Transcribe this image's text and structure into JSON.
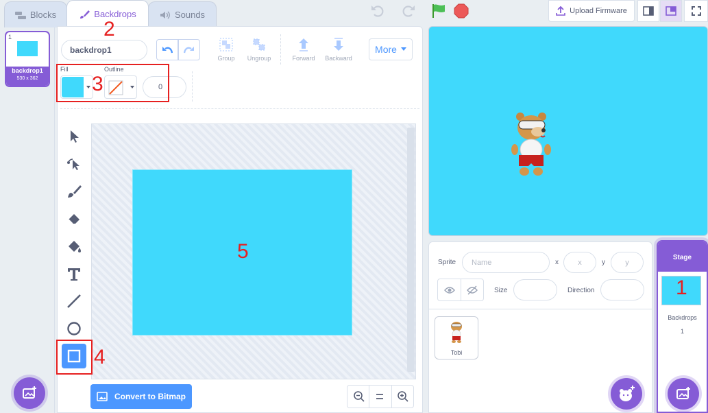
{
  "tabs": [
    {
      "label": "Blocks"
    },
    {
      "label": "Backdrops"
    },
    {
      "label": "Sounds"
    }
  ],
  "header": {
    "upload_firmware": "Upload Firmware"
  },
  "backdrop_list": [
    {
      "index": "1",
      "name": "backdrop1",
      "size": "530 x 362"
    }
  ],
  "toolbar": {
    "name_value": "backdrop1",
    "group": "Group",
    "ungroup": "Ungroup",
    "forward": "Forward",
    "backward": "Backward",
    "more": "More"
  },
  "style": {
    "fill_label": "Fill",
    "outline_label": "Outline",
    "outline_width": "0",
    "fill_color": "#40d9fc"
  },
  "canvas": {
    "convert_label": "Convert to Bitmap"
  },
  "sprite_info": {
    "sprite_label": "Sprite",
    "name_placeholder": "Name",
    "x_label": "x",
    "x_placeholder": "x",
    "y_label": "y",
    "y_placeholder": "y",
    "size_label": "Size",
    "direction_label": "Direction"
  },
  "sprites": [
    {
      "name": "Tobi"
    }
  ],
  "stage_panel": {
    "title": "Stage",
    "backdrops_label": "Backdrops",
    "backdrops_count": "1"
  },
  "annotations": [
    "1",
    "2",
    "3",
    "4",
    "5"
  ]
}
